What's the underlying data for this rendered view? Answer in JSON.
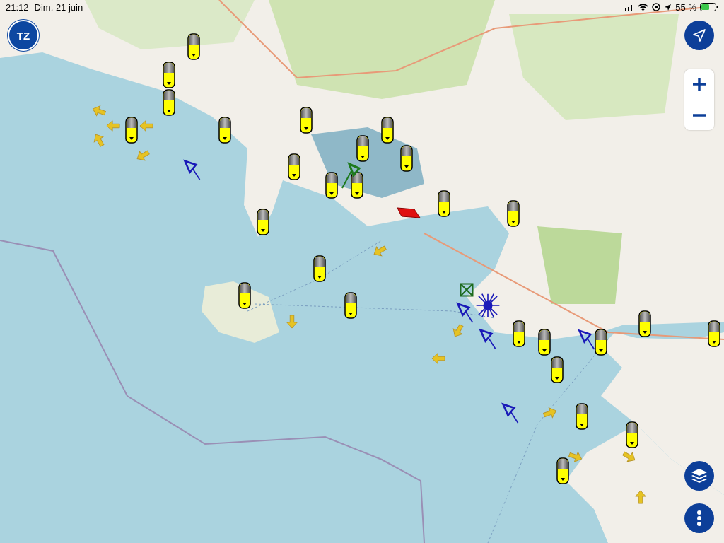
{
  "status_bar": {
    "time": "21:12",
    "date": "Dim. 21 juin",
    "battery": "55 %"
  },
  "logo": {
    "text": "TZ"
  }
}
